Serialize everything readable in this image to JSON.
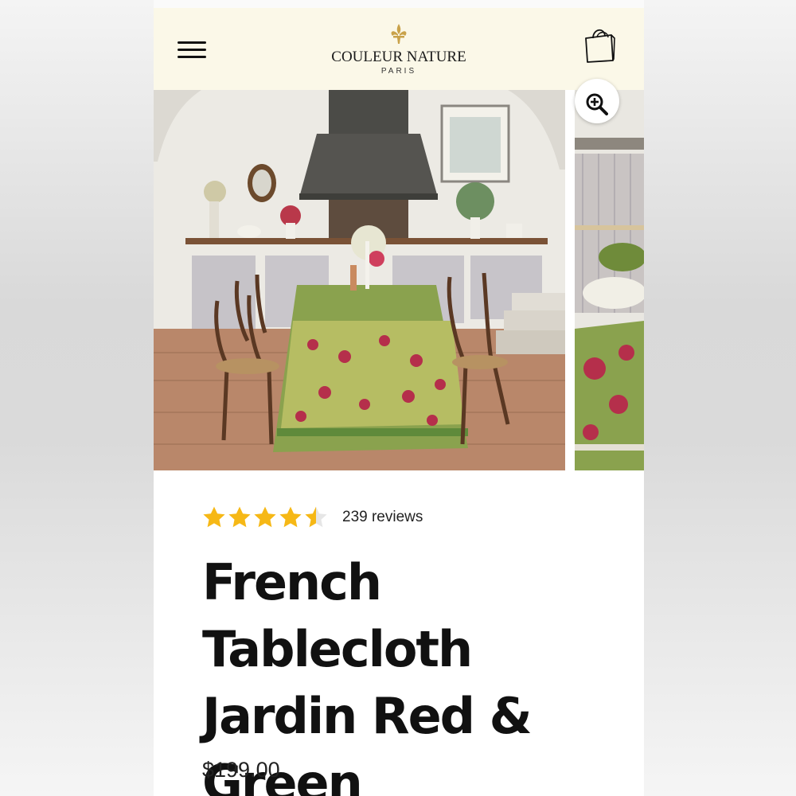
{
  "brand": {
    "name": "COULEUR NATURE",
    "sub": "PARIS",
    "logo_icon": "fleur-de-lis-icon",
    "accent": "#c9a24a"
  },
  "header": {
    "menu_icon": "hamburger-menu-icon",
    "cart_icon": "shopping-bag-icon",
    "background": "#fbf8e8"
  },
  "gallery": {
    "zoom_icon": "zoom-in-icon"
  },
  "product": {
    "rating": 4.5,
    "stars_total": 5,
    "reviews_label": "239 reviews",
    "title": "French Tablecloth Jardin Red & Green",
    "price": "$199.00"
  },
  "colors": {
    "star": "#f6b816",
    "text": "#111111"
  }
}
